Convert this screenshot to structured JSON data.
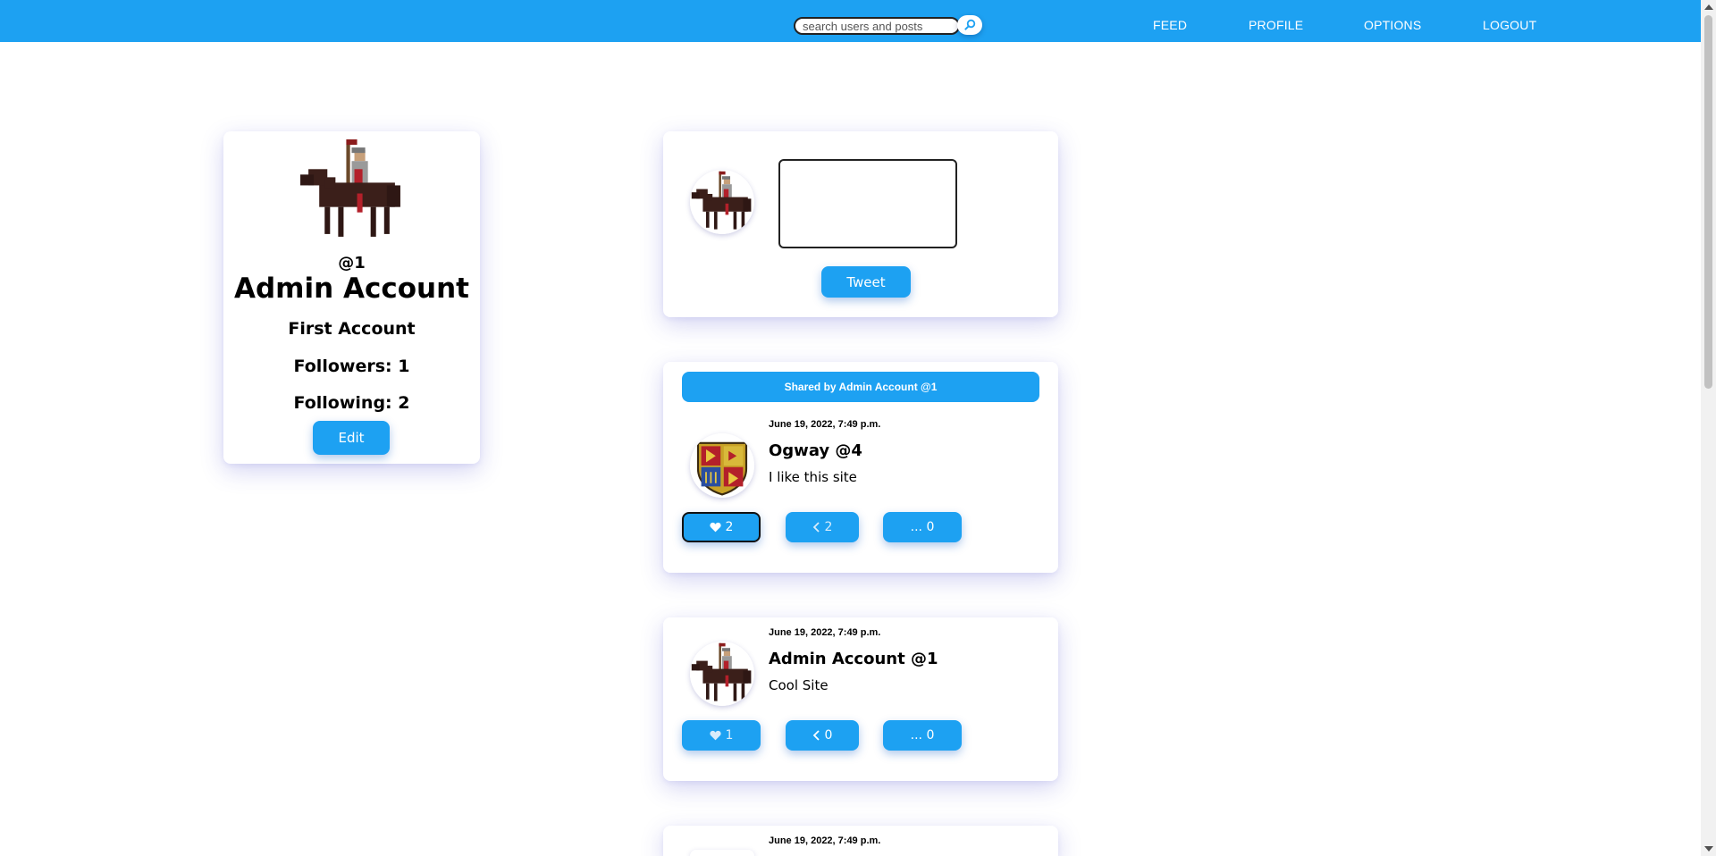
{
  "search": {
    "placeholder": "search users and posts"
  },
  "nav": {
    "feed": "FEED",
    "profile": "PROFILE",
    "options": "OPTIONS",
    "logout": "LOGOUT"
  },
  "profile": {
    "handle": "@1",
    "name": "Admin Account",
    "bio": "First Account",
    "followers": "Followers: 1",
    "following": "Following: 2",
    "edit_label": "Edit"
  },
  "composer": {
    "tweet_label": "Tweet"
  },
  "posts": [
    {
      "shared_by": "Shared by Admin Account @1",
      "date": "June 19, 2022, 7:49 p.m.",
      "author": "Ogway @4",
      "text": "I like this site",
      "likes": "2",
      "shares": "2",
      "comments": "... 0",
      "avatar_icon": "heraldic-shield-icon"
    },
    {
      "date": "June 19, 2022, 7:49 p.m.",
      "author": "Admin Account @1",
      "text": "Cool Site",
      "likes": "1",
      "shares": "0",
      "comments": "... 0",
      "avatar_icon": "knight-on-horse-icon"
    },
    {
      "date": "June 19, 2022, 7:49 p.m."
    }
  ],
  "colors": {
    "accent": "#1da1f2"
  }
}
